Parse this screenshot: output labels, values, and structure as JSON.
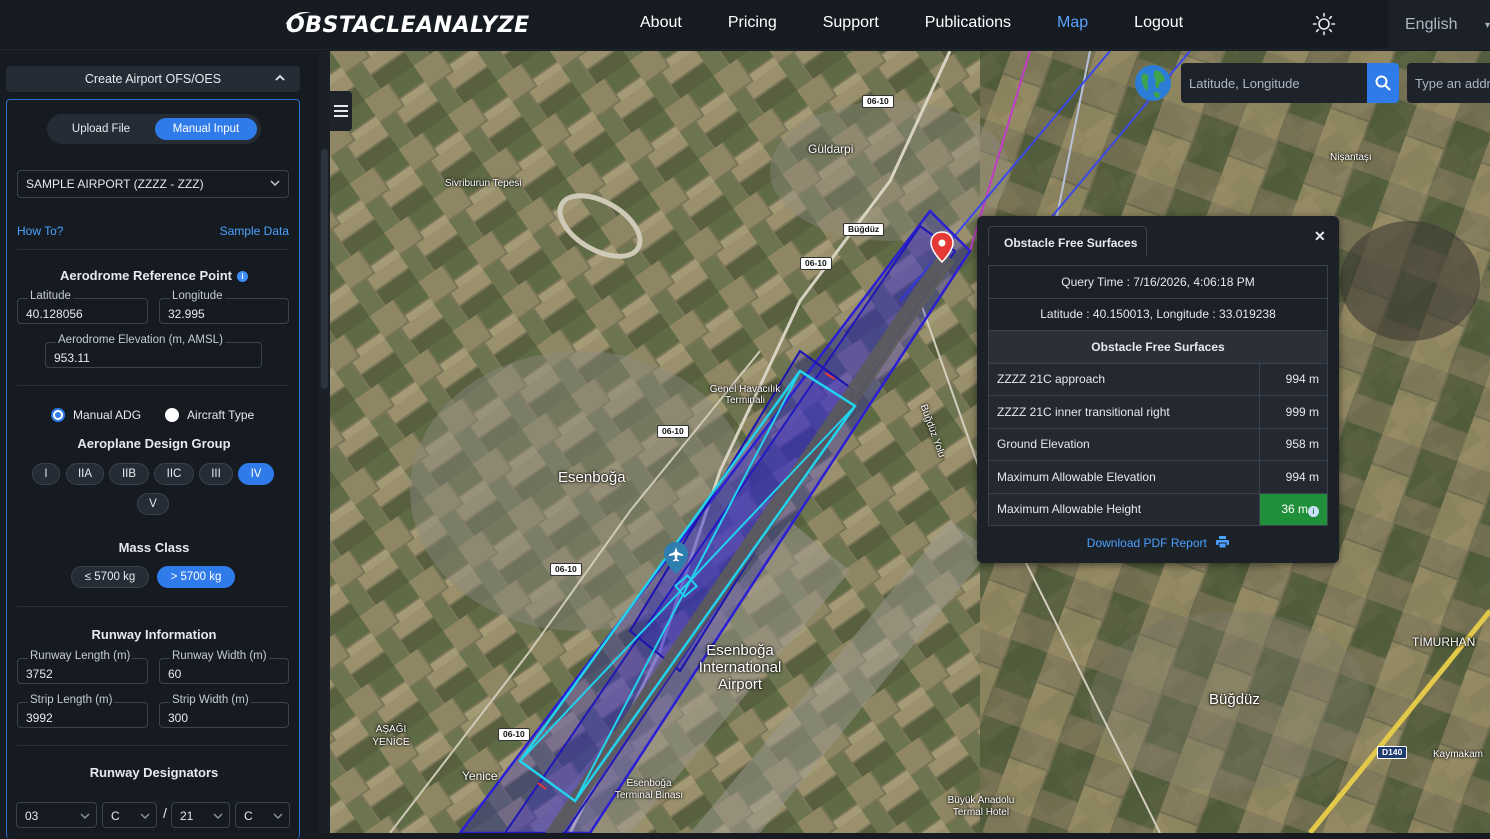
{
  "brand": {
    "name": "OBSTACLEANALYZE"
  },
  "nav": {
    "items": [
      {
        "label": "About"
      },
      {
        "label": "Pricing"
      },
      {
        "label": "Support"
      },
      {
        "label": "Publications"
      },
      {
        "label": "Map",
        "active": true
      },
      {
        "label": "Logout"
      }
    ],
    "language": "English"
  },
  "panel": {
    "header": "Create Airport OFS/OES",
    "mode": {
      "upload": "Upload File",
      "manual": "Manual Input",
      "selected": "manual"
    },
    "airport": "SAMPLE AIRPORT (ZZZZ - ZZZ)",
    "how_to": "How To?",
    "sample_data": "Sample Data",
    "arp": {
      "title": "Aerodrome Reference Point",
      "latitude_label": "Latitude",
      "latitude": "40.128056",
      "longitude_label": "Longitude",
      "longitude": "32.995",
      "elevation_label": "Aerodrome Elevation (m, AMSL)",
      "elevation": "953.11"
    },
    "adg_mode": {
      "manual": "Manual ADG",
      "aircraft": "Aircraft Type",
      "selected": "manual"
    },
    "design_group": {
      "title": "Aeroplane Design Group",
      "options": [
        "I",
        "IIA",
        "IIB",
        "IIC",
        "III",
        "IV",
        "V"
      ],
      "selected": "IV"
    },
    "mass_class": {
      "title": "Mass Class",
      "options": [
        "≤ 5700 kg",
        "> 5700 kg"
      ],
      "selected": "> 5700 kg"
    },
    "runway": {
      "title": "Runway Information",
      "length_label": "Runway Length (m)",
      "length": "3752",
      "width_label": "Runway Width (m)",
      "width": "60",
      "strip_length_label": "Strip Length (m)",
      "strip_length": "3992",
      "strip_width_label": "Strip Width (m)",
      "strip_width": "300"
    },
    "designators": {
      "title": "Runway Designators",
      "d1": "03",
      "s1": "C",
      "slash": "/",
      "d2": "21",
      "s2": "C"
    }
  },
  "map": {
    "latlng_placeholder": "Latitude, Longitude",
    "address_placeholder": "Type an address",
    "labels": {
      "guldarpi": "Güldarpi",
      "nisantasi": "Nişantaşı",
      "sivriburun": "Sivriburun Tepesi",
      "bugduz_small": "Büğdüz",
      "genel_havacilik": "Genel Havacılık Terminali",
      "esenboga": "Esenboğa",
      "esenboga_airport": "Esenboğa International Airport",
      "bugduz_yolu": "Büğdüz Yolu",
      "bugduz": "Büğdüz",
      "timurhan": "TİMURHAN",
      "asagi_yenice": "AŞAĞI YENİCE",
      "yenice": "Yenice",
      "terminal_binasi": "Esenboğa Terminal Binası",
      "buyuk_anadolu": "Büyük Anadolu Termal Hotel",
      "kaymakam": "Kaymakam",
      "road_0610": "06-10",
      "road_d140": "D140",
      "road_bugduz": "Büğdüz"
    }
  },
  "popup": {
    "tab": "Obstacle Free Surfaces",
    "query_time": "Query Time : 7/16/2026, 4:06:18 PM",
    "coords": "Latitude : 40.150013, Longitude : 33.019238",
    "table_title": "Obstacle Free Surfaces",
    "rows": [
      {
        "name": "ZZZZ 21C approach",
        "value": "994 m"
      },
      {
        "name": "ZZZZ 21C inner transitional right",
        "value": "999 m"
      },
      {
        "name": "Ground Elevation",
        "value": "958 m"
      },
      {
        "name": "Maximum Allowable Elevation",
        "value": "994 m"
      },
      {
        "name": "Maximum Allowable Height",
        "value": "36 m"
      }
    ],
    "download": "Download PDF Report"
  },
  "colors": {
    "accent": "#2f7bea",
    "link": "#4aa0ff",
    "ok": "#1f8f3a",
    "surface_outline": "#2a1fd6",
    "runway_box": "#22d3ee"
  }
}
